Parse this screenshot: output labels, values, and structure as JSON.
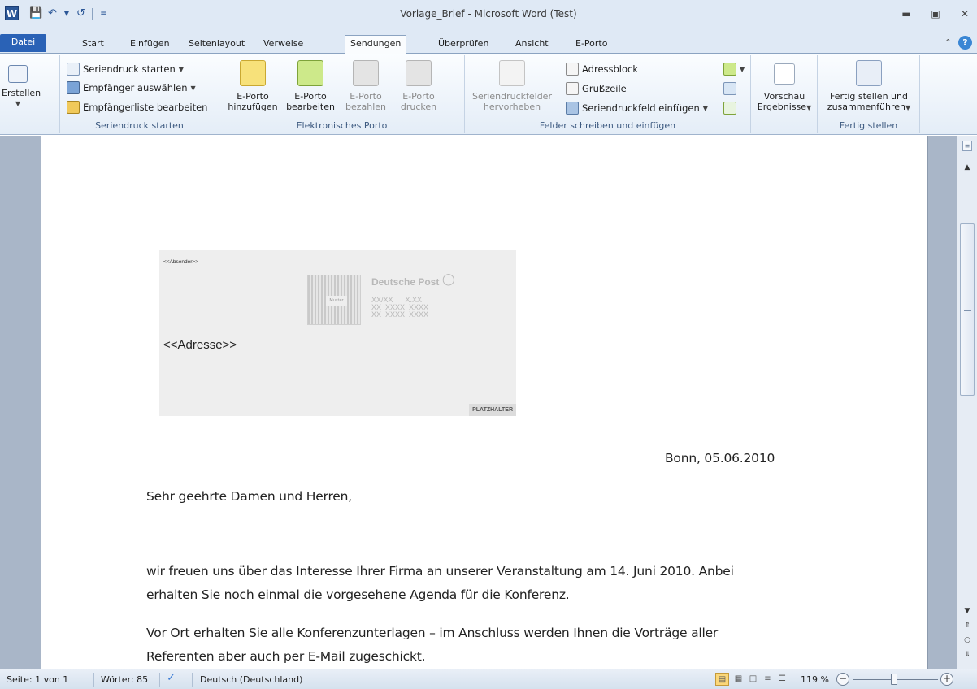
{
  "window": {
    "title": "Vorlage_Brief - Microsoft Word (Test)",
    "app_icon": "W"
  },
  "tabs": [
    "Datei",
    "Start",
    "Einfügen",
    "Seitenlayout",
    "Verweise",
    "Sendungen",
    "Überprüfen",
    "Ansicht",
    "E-Porto"
  ],
  "active_tab": "Sendungen",
  "ribbon": {
    "erstellen": "Erstellen",
    "seriendruck_group": {
      "label": "Seriendruck starten",
      "items": [
        "Seriendruck starten",
        "Empfänger auswählen",
        "Empfängerliste bearbeiten"
      ]
    },
    "eporto_group": {
      "label": "Elektronisches Porto",
      "buttons": [
        {
          "line1": "E-Porto",
          "line2": "hinzufügen"
        },
        {
          "line1": "E-Porto",
          "line2": "bearbeiten"
        },
        {
          "line1": "E-Porto",
          "line2": "bezahlen"
        },
        {
          "line1": "E-Porto",
          "line2": "drucken"
        }
      ]
    },
    "felder_group": {
      "label": "Felder schreiben und einfügen",
      "highlight": {
        "line1": "Seriendruckfelder",
        "line2": "hervorheben"
      },
      "items": [
        "Adressblock",
        "Grußzeile",
        "Seriendruckfeld einfügen"
      ]
    },
    "vorschau": {
      "line1": "Vorschau",
      "line2": "Ergebnisse"
    },
    "fertig_group": {
      "label": "Fertig stellen",
      "line1": "Fertig stellen und",
      "line2": "zusammenführen"
    }
  },
  "document": {
    "absender": "<<Absender>>",
    "adresse": "<<Adresse>>",
    "stamp_brand": "Deutsche Post",
    "stamp_muster": "Muster",
    "stamp_lines": "XX/XX      X.XX\nXX  XXXX  XXXX\nXX  XXXX  XXXX",
    "placeholder": "PLATZHALTER",
    "date_line": "Bonn, 05.06.2010",
    "salutation": "Sehr geehrte Damen und Herren,",
    "p1_line1": "wir freuen uns über das Interesse Ihrer Firma an unserer Veranstaltung am 14. Juni 2010. Anbei",
    "p1_line2": "erhalten Sie noch einmal die vorgesehene Agenda für die Konferenz.",
    "p2_line1": "Vor Ort erhalten Sie alle Konferenzunterlagen  – im Anschluss werden Ihnen die Vorträge aller",
    "p2_line2": "Referenten  aber auch per E-Mail zugeschickt."
  },
  "status": {
    "page": "Seite: 1 von 1",
    "words": "Wörter: 85",
    "language": "Deutsch (Deutschland)",
    "zoom": "119 %",
    "zoom_level_percent": 119
  }
}
